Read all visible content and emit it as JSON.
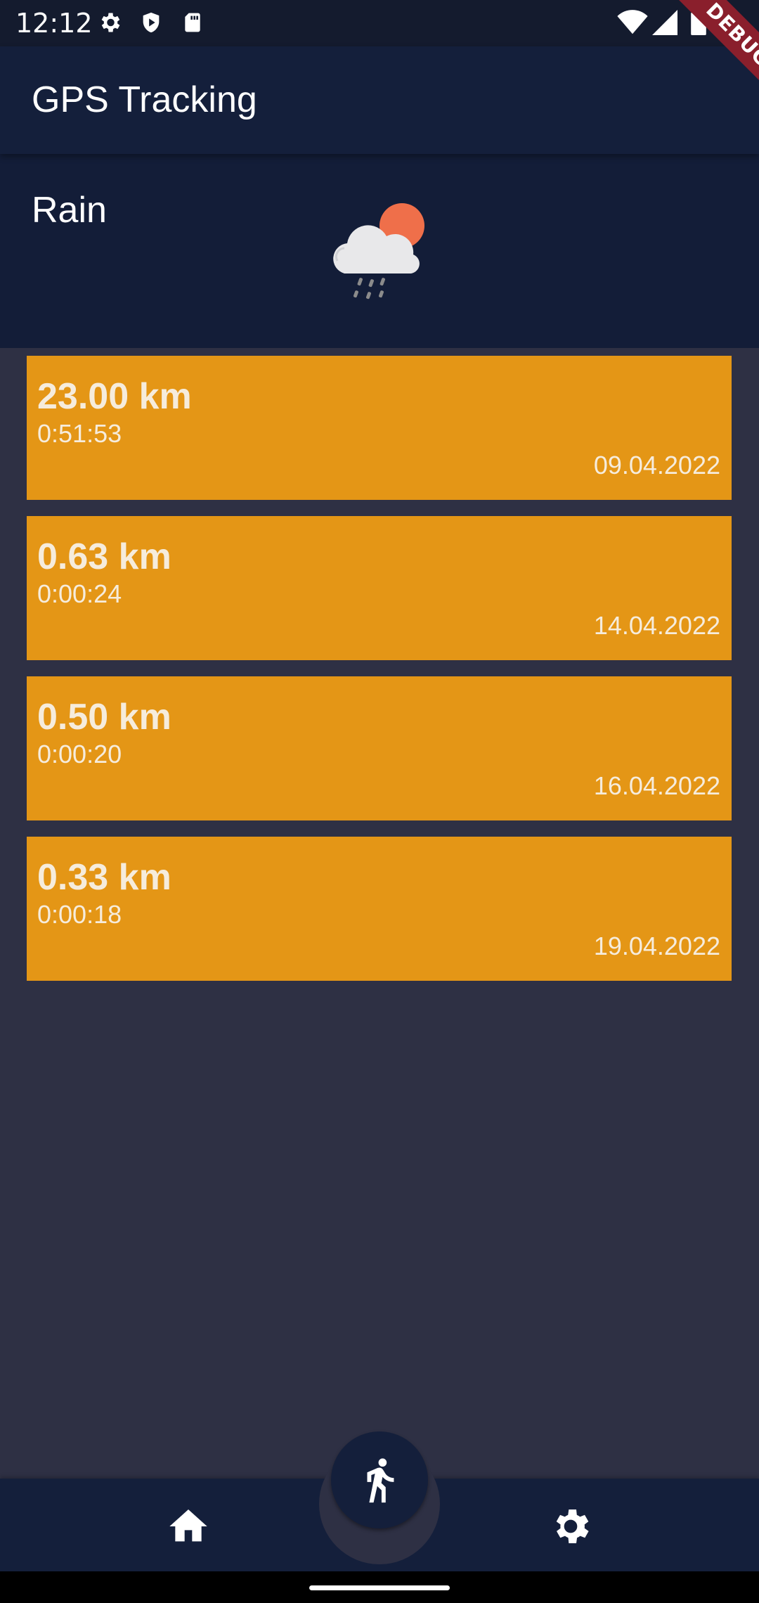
{
  "status_bar": {
    "time": "12:12",
    "icons": [
      "settings-icon",
      "shield-icon",
      "sd-card-icon",
      "wifi-icon",
      "signal-icon",
      "battery-icon"
    ]
  },
  "debug_banner": "DEBUG",
  "app_bar": {
    "title": "GPS Tracking"
  },
  "weather": {
    "label": "Rain",
    "icon": "rain-cloud-sun-icon"
  },
  "tracks": [
    {
      "distance": "23.00 km",
      "duration": "0:51:53",
      "date": "09.04.2022"
    },
    {
      "distance": "0.63 km",
      "duration": "0:00:24",
      "date": "14.04.2022"
    },
    {
      "distance": "0.50 km",
      "duration": "0:00:20",
      "date": "16.04.2022"
    },
    {
      "distance": "0.33 km",
      "duration": "0:00:18",
      "date": "19.04.2022"
    }
  ],
  "bottom_nav": {
    "items": [
      "home-icon",
      "run-icon",
      "gear-icon"
    ]
  },
  "colors": {
    "background": "#2e3044",
    "app_bar": "#141f3b",
    "card": "#e49616",
    "card_text": "#f6ecdc",
    "sun": "#ef6f4a"
  }
}
